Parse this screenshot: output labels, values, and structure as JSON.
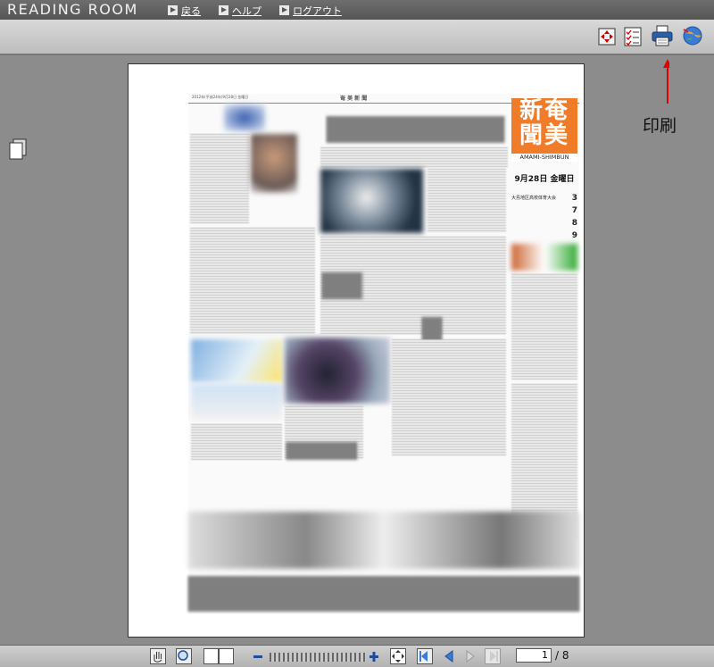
{
  "app": {
    "title": "READING ROOM"
  },
  "nav": {
    "back": "戻る",
    "help": "ヘルプ",
    "logout": "ログアウト"
  },
  "toolbar": {
    "icons": [
      "fit-page-icon",
      "checklist-icon",
      "printer-icon",
      "globe-link-icon"
    ]
  },
  "annotation": {
    "print_label": "印刷",
    "arrow_color": "#e00000"
  },
  "newspaper": {
    "header_date": "2012年(平成24年)9月28日  金曜日",
    "header_name": "奄 美 新 聞",
    "masthead": "奄美新聞",
    "masthead_top": "新奄",
    "masthead_bottom": "聞美",
    "masthead_sub": "AMAMI-SHIMBUN",
    "masthead_color": "#f07c2a",
    "date": "9月28日 金曜日",
    "index": [
      {
        "label": "大島地区高校体育大会",
        "page": "3"
      },
      {
        "label": "",
        "page": "7"
      },
      {
        "label": "",
        "page": "8"
      },
      {
        "label": "",
        "page": "9"
      }
    ]
  },
  "pager": {
    "current": "1",
    "total": "/ 8"
  }
}
